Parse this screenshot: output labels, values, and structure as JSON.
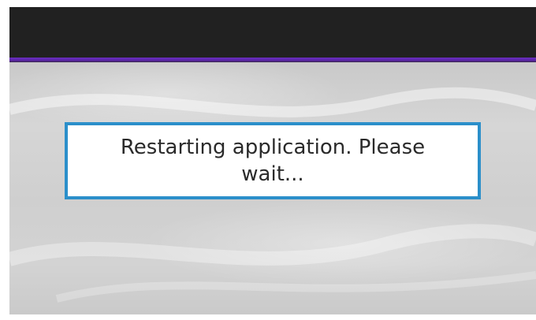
{
  "dialog": {
    "message": "Restarting application. Please wait..."
  },
  "colors": {
    "topbar": "#212121",
    "accent_line": "#5a24a8",
    "dialog_border": "#2b8fca",
    "dialog_background": "#ffffff",
    "text": "#2a2a2a"
  }
}
